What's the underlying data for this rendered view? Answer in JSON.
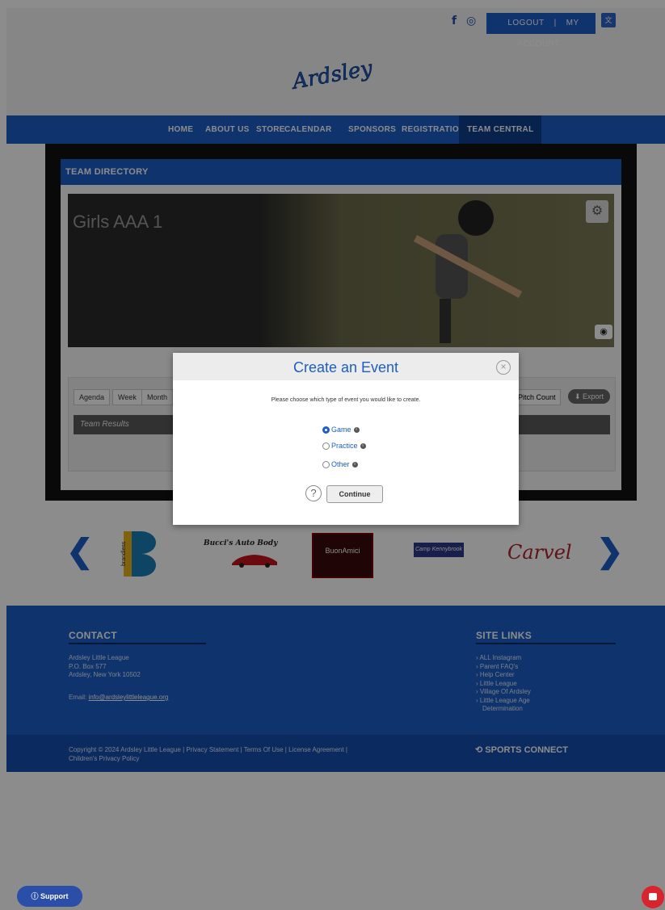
{
  "header": {
    "social": [
      "f",
      "◎"
    ],
    "logout": "LOGOUT",
    "separator": "|",
    "my_account": "MY ACCOUNT",
    "logo_text": "Ardsley"
  },
  "nav": {
    "items": [
      "HOME",
      "ABOUT US",
      "STORE",
      "CALENDAR",
      "SPONSORS",
      "REGISTRATION",
      "TEAM CENTRAL"
    ],
    "active": "TEAM CENTRAL"
  },
  "team": {
    "directory_title": "TEAM DIRECTORY",
    "team_name": "Girls AAA 1",
    "tabs": [
      "Agenda",
      "Week",
      "Month"
    ],
    "pitch_count": "Pitch Count",
    "export": "Export",
    "results": "Team Results"
  },
  "sponsors": {
    "items": [
      "brandless",
      "Bucci's Auto Body",
      "BuonAmici",
      "Camp Kennybrook",
      "Carvel"
    ]
  },
  "footer": {
    "contact_title": "CONTACT",
    "contact_lines": [
      "Ardsley Little League",
      "P.O. Box 577",
      "Ardsley, New York 10502"
    ],
    "email_label": "Email:",
    "email": "info@ardsleylittleleague.org",
    "links_title": "SITE LINKS",
    "links": [
      "ALL Instagram",
      "Parent FAQ's",
      "Help Center",
      "Little League",
      "Village Of Ardsley",
      "Little League Age",
      "Determination"
    ],
    "copyright": "Copyright © 2024 Ardsley Little League | Privacy Statement | Terms Of Use | License Agreement |",
    "copyright2": "Children's Privacy Policy",
    "brand": "SPORTS CONNECT"
  },
  "modal": {
    "title": "Create an Event",
    "prompt": "Please choose which type of event you would like to create.",
    "options": [
      "Game",
      "Practice",
      "Other"
    ],
    "selected": "Game",
    "continue": "Continue"
  },
  "support": {
    "label": "Support"
  },
  "colors": {
    "brand_blue": "#1c5ec6",
    "dark_blue": "#0f3e8e",
    "chat_red": "#d9232d"
  }
}
